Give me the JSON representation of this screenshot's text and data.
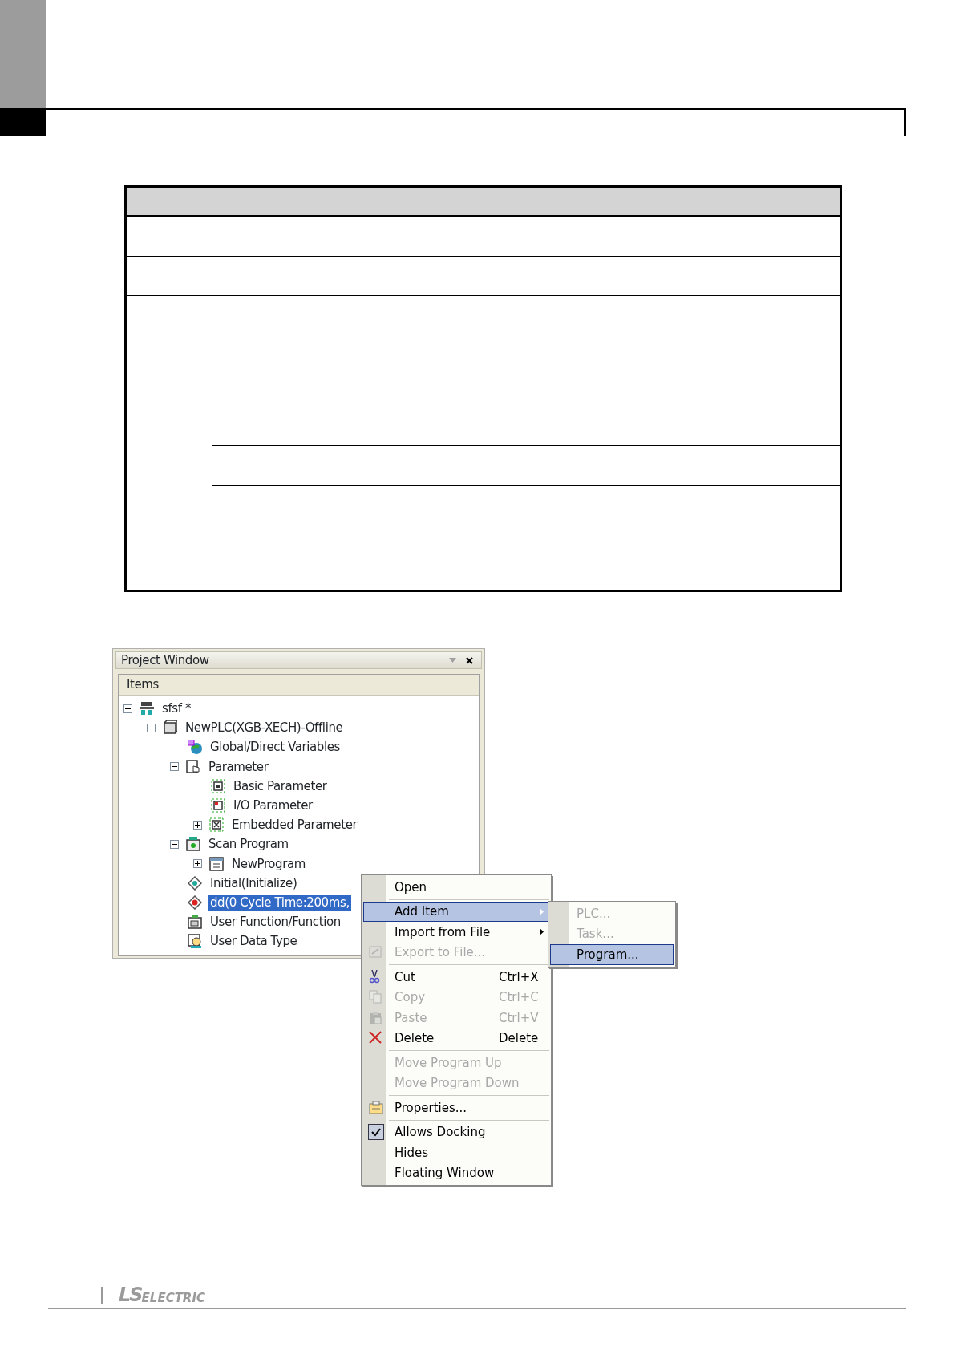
{
  "project_window": {
    "title": "Project Window",
    "column_header": "Items",
    "tree": [
      {
        "label": "sfsf *",
        "expanded": true,
        "selected": false,
        "children": [
          {
            "label": "NewPLC(XGB-XECH)-Offline",
            "expanded": true,
            "selected": false,
            "children": [
              {
                "label": "Global/Direct Variables",
                "selected": false
              },
              {
                "label": "Parameter",
                "expanded": true,
                "selected": false,
                "children": [
                  {
                    "label": "Basic Parameter",
                    "selected": false
                  },
                  {
                    "label": "I/O Parameter",
                    "selected": false
                  },
                  {
                    "label": "Embedded Parameter",
                    "expanded": false,
                    "selected": false
                  }
                ]
              },
              {
                "label": "Scan Program",
                "expanded": true,
                "selected": false,
                "children": [
                  {
                    "label": "NewProgram",
                    "expanded": false,
                    "selected": false
                  }
                ]
              },
              {
                "label": "Initial(Initialize)",
                "selected": false
              },
              {
                "label": "dd(0 Cycle Time:200ms,",
                "selected": true
              },
              {
                "label": "User Function/Function",
                "selected": false
              },
              {
                "label": "User Data Type",
                "selected": false
              }
            ]
          }
        ]
      }
    ]
  },
  "context_menu": [
    {
      "kind": "item",
      "label": "Open",
      "selected": false,
      "disabled": false
    },
    {
      "kind": "separator"
    },
    {
      "kind": "item",
      "label": "Add Item",
      "selected": true,
      "disabled": false,
      "submenu": true
    },
    {
      "kind": "item",
      "label": "Import from File",
      "selected": false,
      "disabled": false,
      "submenu": true
    },
    {
      "kind": "item",
      "label": "Export to File...",
      "selected": false,
      "disabled": true
    },
    {
      "kind": "separator"
    },
    {
      "kind": "item",
      "label": "Cut",
      "shortcut": "Ctrl+X",
      "selected": false,
      "disabled": false
    },
    {
      "kind": "item",
      "label": "Copy",
      "shortcut": "Ctrl+C",
      "selected": false,
      "disabled": true
    },
    {
      "kind": "item",
      "label": "Paste",
      "shortcut": "Ctrl+V",
      "selected": false,
      "disabled": true
    },
    {
      "kind": "item",
      "label": "Delete",
      "shortcut": "Delete",
      "selected": false,
      "disabled": false
    },
    {
      "kind": "separator"
    },
    {
      "kind": "item",
      "label": "Move Program Up",
      "selected": false,
      "disabled": true
    },
    {
      "kind": "item",
      "label": "Move Program Down",
      "selected": false,
      "disabled": true
    },
    {
      "kind": "separator"
    },
    {
      "kind": "item",
      "label": "Properties...",
      "selected": false,
      "disabled": false
    },
    {
      "kind": "separator"
    },
    {
      "kind": "item",
      "label": "Allows Docking",
      "selected": false,
      "disabled": false,
      "checked": true
    },
    {
      "kind": "item",
      "label": "Hides",
      "selected": false,
      "disabled": false,
      "checked": false
    },
    {
      "kind": "item",
      "label": "Floating Window",
      "selected": false,
      "disabled": false,
      "checked": false
    }
  ],
  "submenu": [
    {
      "label": "PLC...",
      "selected": false,
      "disabled": true
    },
    {
      "label": "Task...",
      "selected": false,
      "disabled": true
    },
    {
      "label": "Program...",
      "selected": true,
      "disabled": false
    }
  ],
  "footer": {
    "logo_mark": "LS",
    "logo_word": "ELECTRIC"
  }
}
